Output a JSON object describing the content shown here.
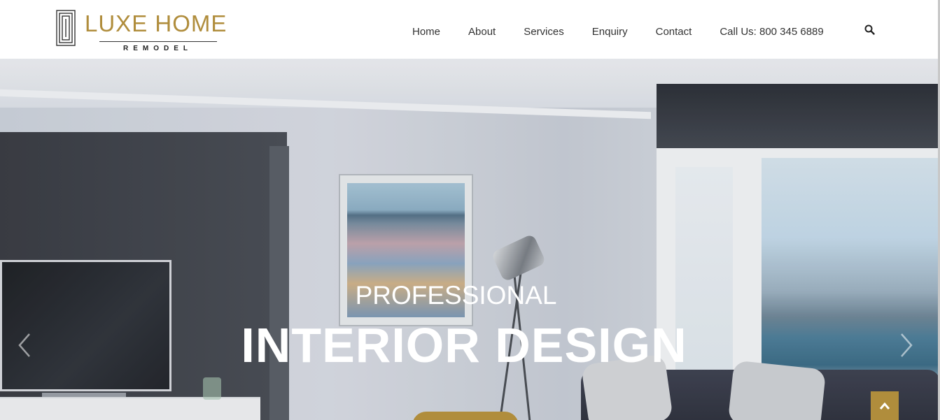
{
  "brand": {
    "name": "LUXE HOME",
    "tagline": "REMODEL",
    "gold": "#b08d3c"
  },
  "nav": {
    "items": [
      {
        "label": "Home"
      },
      {
        "label": "About"
      },
      {
        "label": "Services"
      },
      {
        "label": "Enquiry"
      },
      {
        "label": "Contact"
      },
      {
        "label": "Call Us: 800 345 6889"
      }
    ],
    "search_icon": "search-icon"
  },
  "hero": {
    "kicker": "PROFESSIONAL",
    "title": "INTERIOR DESIGN",
    "prev_icon": "chevron-left-icon",
    "next_icon": "chevron-right-icon"
  },
  "back_to_top": {
    "icon": "chevron-up-icon"
  }
}
